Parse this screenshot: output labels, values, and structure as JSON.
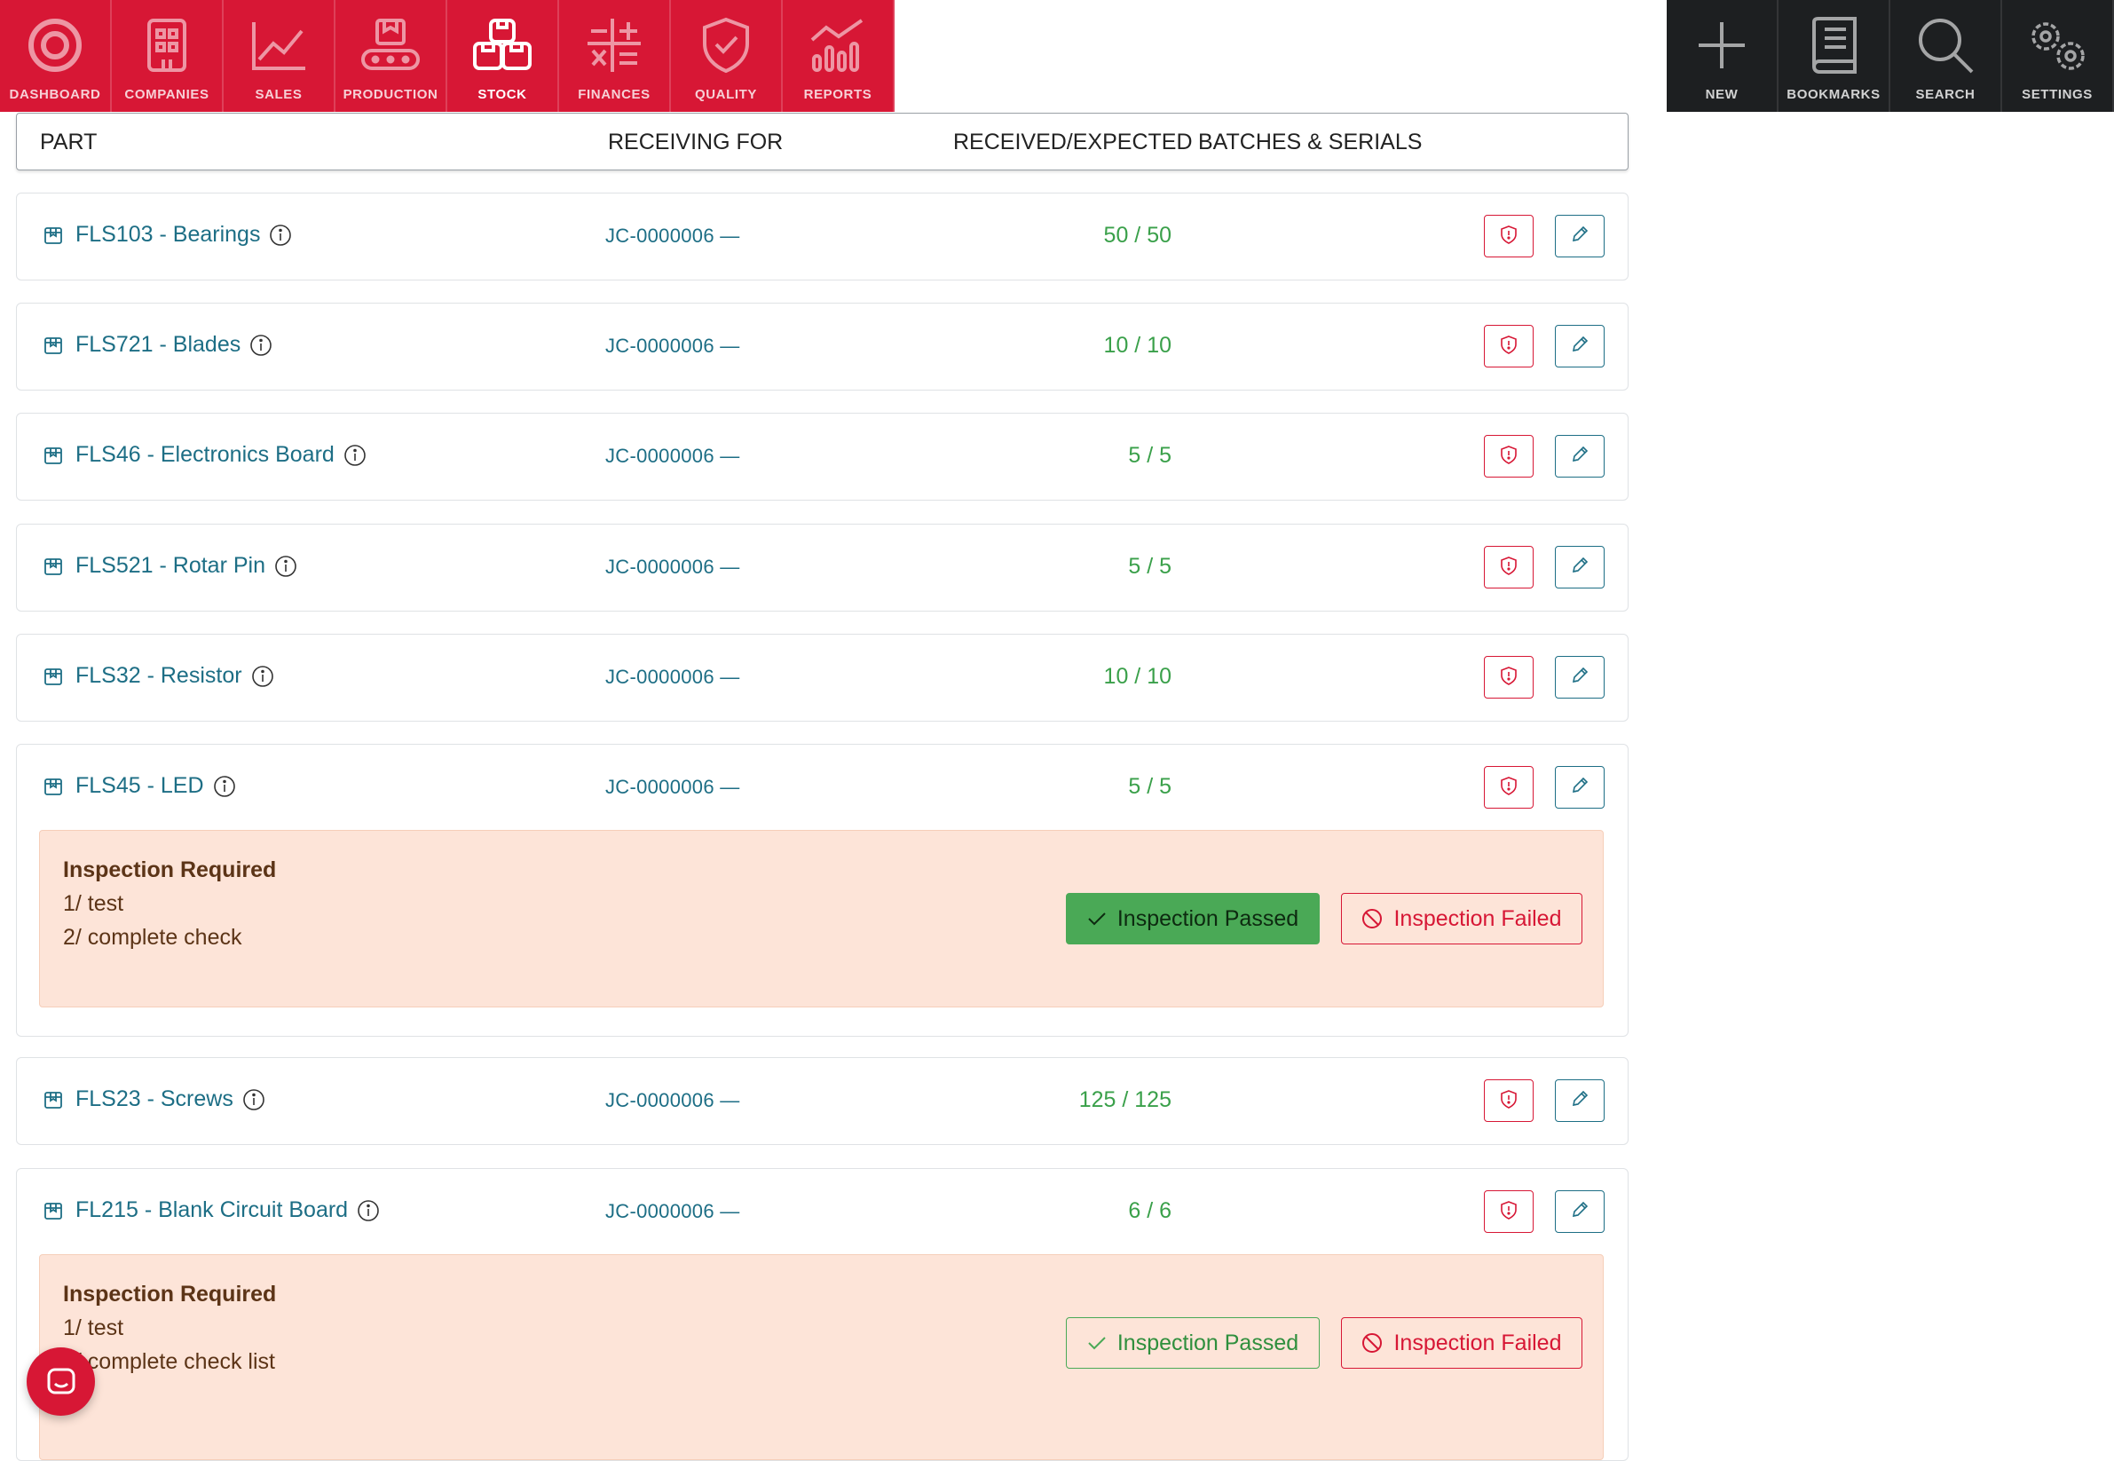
{
  "nav": {
    "left": [
      {
        "label": "DASHBOARD",
        "icon": "dashboard-icon"
      },
      {
        "label": "COMPANIES",
        "icon": "building-icon"
      },
      {
        "label": "SALES",
        "icon": "line-chart-icon"
      },
      {
        "label": "PRODUCTION",
        "icon": "conveyor-icon"
      },
      {
        "label": "STOCK",
        "icon": "boxes-icon",
        "active": true
      },
      {
        "label": "FINANCES",
        "icon": "calculator-icon"
      },
      {
        "label": "QUALITY",
        "icon": "shield-check-icon"
      },
      {
        "label": "REPORTS",
        "icon": "bar-chart-icon"
      }
    ],
    "right": [
      {
        "label": "NEW",
        "icon": "plus-icon"
      },
      {
        "label": "BOOKMARKS",
        "icon": "book-icon"
      },
      {
        "label": "SEARCH",
        "icon": "search-icon"
      },
      {
        "label": "SETTINGS",
        "icon": "gear-icon"
      }
    ]
  },
  "table": {
    "headers": {
      "part": "PART",
      "receiving_for": "RECEIVING FOR",
      "received_expected": "RECEIVED/EXPECTED",
      "batches_serials": "BATCHES & SERIALS"
    },
    "rows": [
      {
        "part": "FLS103 - Bearings",
        "receiving_for": "JC-0000006 —",
        "qty": "50 / 50"
      },
      {
        "part": "FLS721 - Blades",
        "receiving_for": "JC-0000006 —",
        "qty": "10 / 10"
      },
      {
        "part": "FLS46 - Electronics Board",
        "receiving_for": "JC-0000006 —",
        "qty": "5 / 5"
      },
      {
        "part": "FLS521 - Rotar Pin",
        "receiving_for": "JC-0000006 —",
        "qty": "5 / 5"
      },
      {
        "part": "FLS32 - Resistor",
        "receiving_for": "JC-0000006 —",
        "qty": "10 / 10"
      },
      {
        "part": "FLS45 - LED",
        "receiving_for": "JC-0000006 —",
        "qty": "5 / 5",
        "inspection": {
          "title": "Inspection Required",
          "lines": [
            "1/ test",
            "2/ complete check"
          ],
          "pass_label": "Inspection Passed",
          "fail_label": "Inspection Failed",
          "passed": true
        }
      },
      {
        "part": "FLS23 - Screws",
        "receiving_for": "JC-0000006 —",
        "qty": "125 / 125"
      },
      {
        "part": "FL215 - Blank Circuit Board",
        "receiving_for": "JC-0000006 —",
        "qty": "6 / 6",
        "inspection": {
          "title": "Inspection Required",
          "lines": [
            "1/ test",
            "2/ complete check list"
          ],
          "pass_label": "Inspection Passed",
          "fail_label": "Inspection Failed",
          "passed": false
        }
      }
    ]
  },
  "colors": {
    "brand_red": "#d71735",
    "dark_nav": "#1d1f21",
    "link_teal": "#1d6e85",
    "qty_green": "#3aa04a",
    "inspection_bg": "#fde4d8"
  }
}
